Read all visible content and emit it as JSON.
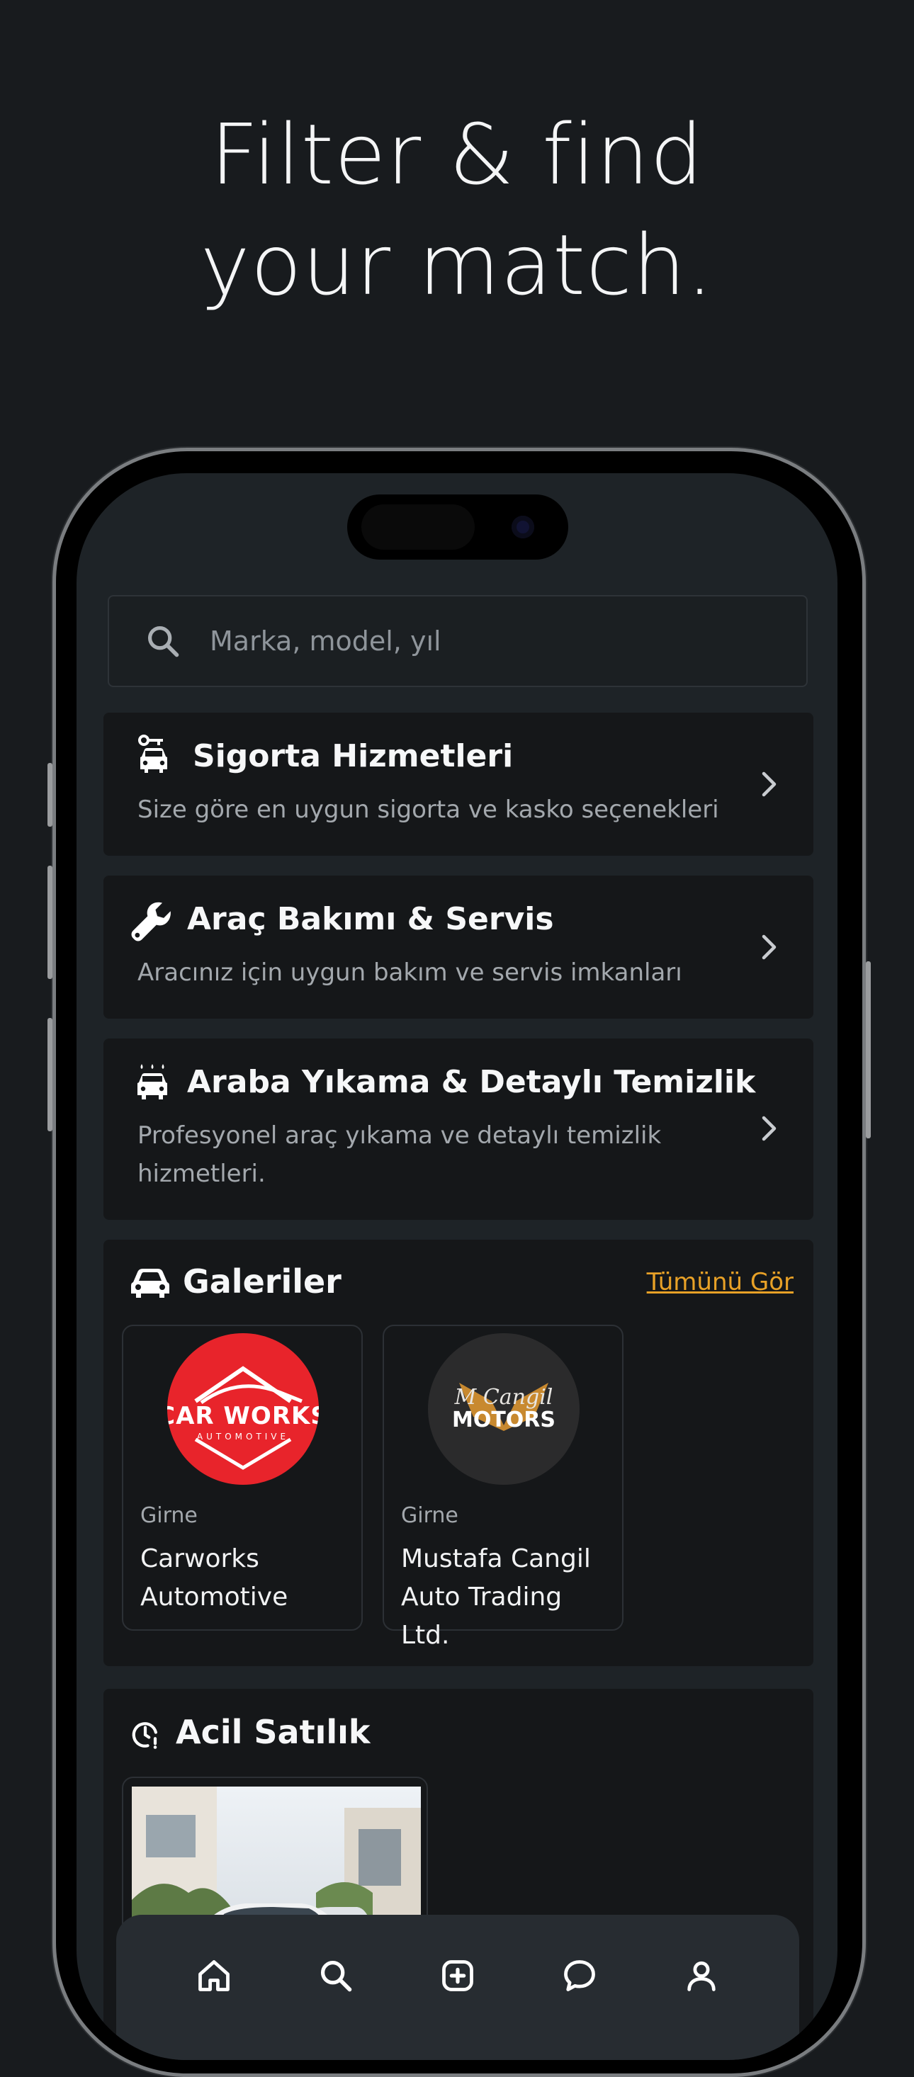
{
  "promo": {
    "headline_line1": "Filter & find",
    "headline_line2": "your match."
  },
  "search": {
    "placeholder": "Marka, model, yıl"
  },
  "services": [
    {
      "title": "Sigorta Hizmetleri",
      "subtitle": "Size göre en uygun sigorta ve kasko seçenekleri",
      "icon": "car-key-icon"
    },
    {
      "title": "Araç Bakımı & Servis",
      "subtitle": "Aracınız için uygun bakım ve servis imkanları",
      "icon": "wrench-icon"
    },
    {
      "title": "Araba Yıkama & Detaylı Temizlik",
      "subtitle_line1": "Profesyonel araç yıkama ve detaylı temizlik",
      "subtitle_line2": "hizmetleri.",
      "icon": "car-wash-icon"
    }
  ],
  "galleries": {
    "title": "Galeriler",
    "see_all": "Tümünü Gör",
    "items": [
      {
        "city": "Girne",
        "name_line1": "Carworks",
        "name_line2": "Automotive",
        "logo_text": "CAR WORKS",
        "logo_sub": "AUTOMOTIVE",
        "logo_color": "#e8242b"
      },
      {
        "city": "Girne",
        "name_line1": "Mustafa Cangil",
        "name_line2": "Auto Trading Ltd.",
        "logo_text": "MOTORS",
        "logo_script": "M Cangil",
        "logo_color": "#2b2b2c",
        "accent": "#c8892f"
      }
    ]
  },
  "urgent": {
    "title": "Acil Satılık"
  },
  "tabbar": {
    "items": [
      "home-icon",
      "search-icon",
      "add-listing-icon",
      "messages-icon",
      "profile-icon"
    ]
  },
  "colors": {
    "background": "#181b1e",
    "card": "#151719",
    "accent": "#e8a127"
  }
}
